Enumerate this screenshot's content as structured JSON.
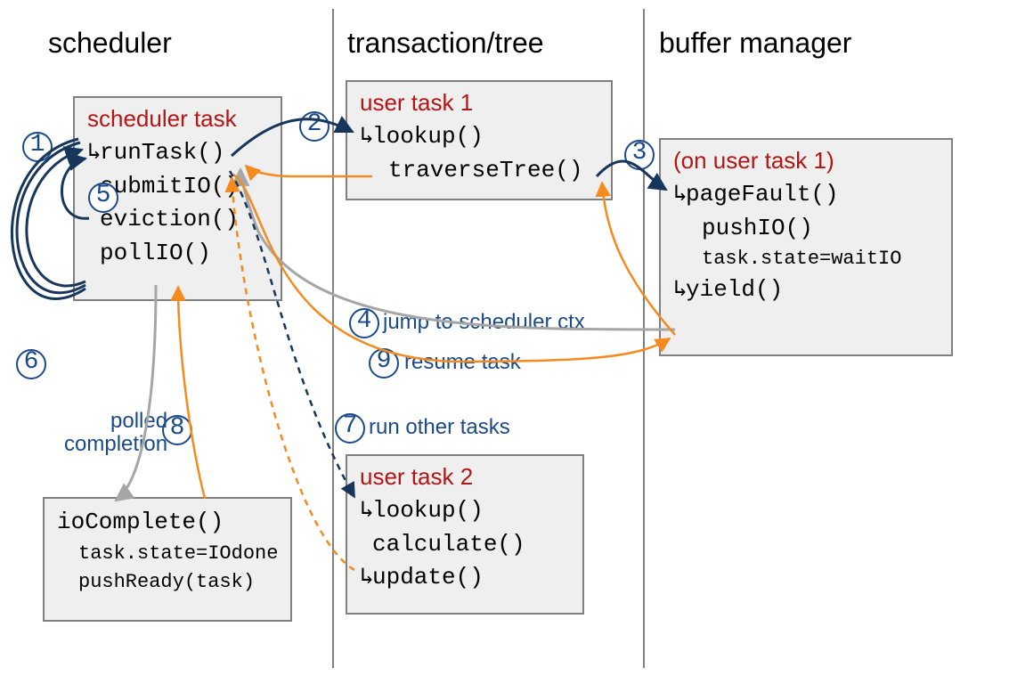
{
  "columns": {
    "scheduler": "scheduler",
    "transaction": "transaction/tree",
    "buffer": "buffer manager"
  },
  "scheduler_task": {
    "title": "scheduler task",
    "lines": [
      "runTask()",
      "submitIO()",
      "eviction()",
      "pollIO()"
    ]
  },
  "io_complete": {
    "lines": [
      "ioComplete()",
      "task.state=IOdone",
      "pushReady(task)"
    ]
  },
  "user_task_1": {
    "title": "user task 1",
    "lines": [
      "lookup()",
      "traverseTree()"
    ]
  },
  "user_task_2": {
    "title": "user task 2",
    "lines": [
      "lookup()",
      "calculate()",
      "update()"
    ]
  },
  "buffer_task": {
    "title": "(on user task 1)",
    "lines": [
      "pageFault()",
      "pushIO()",
      "task.state=waitIO",
      "yield()"
    ]
  },
  "steps": {
    "1": "1",
    "2": "2",
    "3": "3",
    "4": "4",
    "5": "5",
    "6": "6",
    "7": "7",
    "8": "8",
    "9": "9"
  },
  "annotations": {
    "jump": "jump to scheduler ctx",
    "resume": "resume task",
    "run_other": "run other tasks",
    "polled": "polled\ncompletion"
  },
  "colors": {
    "navy": "#16365c",
    "orange": "#f58b1f",
    "grey": "#a6a6a6"
  }
}
